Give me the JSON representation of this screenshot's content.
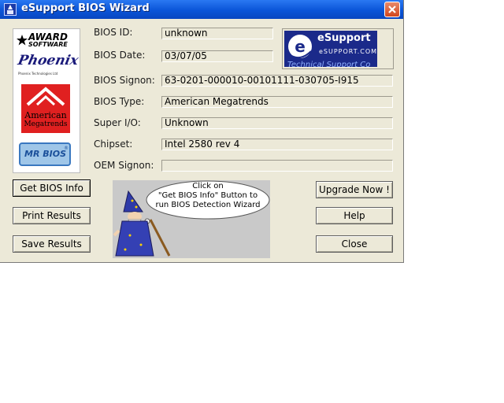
{
  "window": {
    "title": "eSupport BIOS Wizard"
  },
  "logos": {
    "award_line1": "AWARD",
    "award_line2": "SOFTWARE",
    "phoenix": "Phoenix",
    "phoenix_sub": "Phoenix Technologies Ltd",
    "ami_line1": "American",
    "ami_line2": "Megatrends",
    "mrbios": "MR BIOS",
    "mrbios_mark": "®"
  },
  "fields": [
    {
      "label": "BIOS ID:",
      "value": "unknown"
    },
    {
      "label": "BIOS Date:",
      "value": "03/07/05"
    },
    {
      "label": "BIOS Signon:",
      "value": "63-0201-000010-00101111-030705-I915"
    },
    {
      "label": "BIOS Type:",
      "value": "American Megatrends"
    },
    {
      "label": "Super I/O:",
      "value": "Unknown"
    },
    {
      "label": "Chipset:",
      "value": "Intel 2580 rev 4"
    },
    {
      "label": "OEM Signon:",
      "value": ""
    }
  ],
  "esupport": {
    "brand": "eSupport",
    "url": "eSUPPORT.COM",
    "tagline": "Technical Support Co"
  },
  "buttons": {
    "get_bios_info": "Get BIOS Info",
    "print_results": "Print Results",
    "save_results": "Save Results",
    "upgrade_now": "Upgrade Now !",
    "help": "Help",
    "close": "Close"
  },
  "wizard_bubble": {
    "line1": "Click on",
    "line2": "\"Get BIOS Info\" Button to",
    "line3": "run BIOS Detection Wizard"
  },
  "colors": {
    "titlebar": "#0a55d8",
    "window_bg": "#ece9d8",
    "esupport_blue": "#1b2a8a",
    "ami_red": "#e02020"
  }
}
